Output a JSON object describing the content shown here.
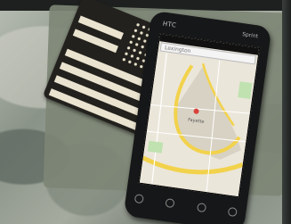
{
  "photo": {
    "phone_brand": "HTC",
    "carrier": "Sprint",
    "search_placeholder": "Lexington",
    "map_label": "Fayette"
  },
  "colors": {
    "background_camo": "#8a9388",
    "flag_dark": "#23211d",
    "flag_light": "#e9e3cf",
    "phone_body": "#161718",
    "map_road": "#f2d24b",
    "map_park": "#bfe2b0"
  }
}
